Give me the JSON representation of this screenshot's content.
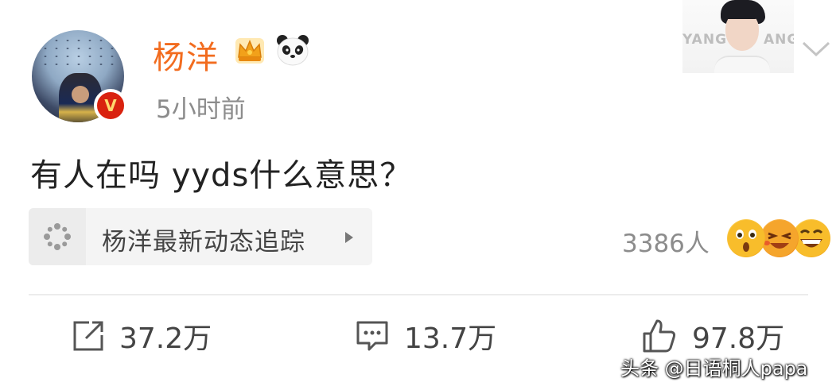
{
  "post": {
    "author": {
      "name": "杨洋",
      "verified_badge": "V",
      "badges": [
        "crown-icon",
        "panda-icon"
      ]
    },
    "timestamp": "5小时前",
    "content": "有人在吗 yyds什么意思？",
    "cover_card": {
      "text_left": "YANG",
      "text_right": "ANG"
    },
    "topic_link": {
      "label": "杨洋最新动态追踪"
    },
    "reactions": {
      "count": "3386人",
      "emojis": [
        "surprised-emoji",
        "laugh-emoji",
        "grin-emoji"
      ]
    },
    "actions": {
      "repost": "37.2万",
      "comment": "13.7万",
      "like": "97.8万"
    },
    "watermark": "头条 @日语桐人papa"
  },
  "colors": {
    "username": "#f26c1f",
    "verified_badge": "#d9220f",
    "muted_text": "#8c8c8c"
  }
}
